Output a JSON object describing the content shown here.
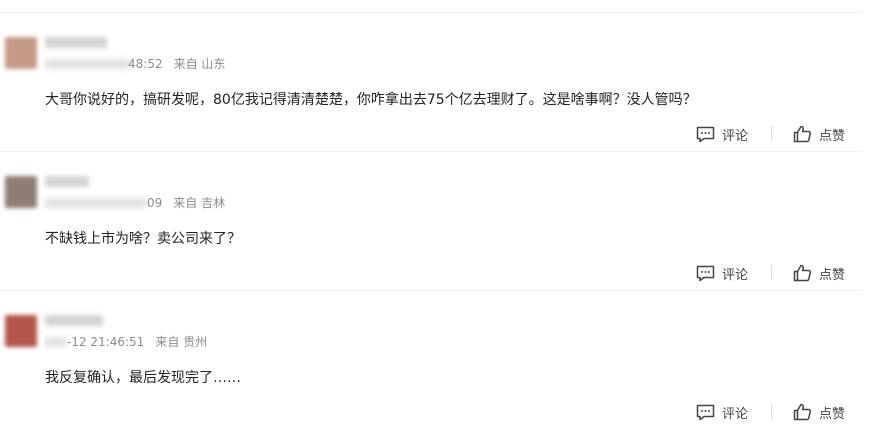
{
  "comments": [
    {
      "time_tail": "48:52",
      "from_label": "来自 山东",
      "text": "大哥你说好的，搞研发呢，80亿我记得清清楚楚，你咋拿出去75个亿去理财了。这是啥事啊？没人管吗？",
      "comment_label": "评论",
      "like_label": "点赞",
      "avatar_color": "#c49a86"
    },
    {
      "time_tail": "09",
      "from_label": "来自 吉林",
      "text": "不缺钱上市为啥？卖公司来了？",
      "comment_label": "评论",
      "like_label": "点赞",
      "avatar_color": "#8e7d74"
    },
    {
      "time_tail": "-12 21:46:51",
      "from_label": "来自 贵州",
      "text": "我反复确认，最后发现完了……",
      "comment_label": "评论",
      "like_label": "点赞",
      "avatar_color": "#b2574a"
    }
  ]
}
